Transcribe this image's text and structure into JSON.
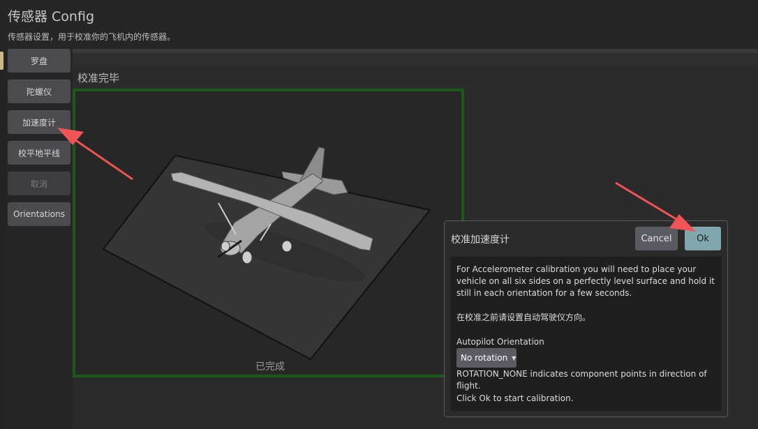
{
  "header": {
    "title": "传感器 Config",
    "subtitle": "传感器设置，用于校准你的飞机内的传感器。"
  },
  "sidebar": {
    "items": [
      {
        "label": "罗盘"
      },
      {
        "label": "陀螺仪"
      },
      {
        "label": "加速度计"
      },
      {
        "label": "校平地平线"
      },
      {
        "label": "取消",
        "disabled": true
      },
      {
        "label": "Orientations"
      }
    ]
  },
  "main": {
    "calibration_title": "校准完毕",
    "done_label": "已完成"
  },
  "dialog": {
    "title": "校准加速度计",
    "cancel_label": "Cancel",
    "ok_label": "Ok",
    "instructions": "For Accelerometer calibration you will need to place your vehicle on all six sides on a perfectly level surface and hold it still in each orientation for a few seconds.",
    "note": "在校准之前请设置自动驾驶仪方向。",
    "orientation_label": "Autopilot Orientation",
    "orientation_value": "No rotation",
    "orientation_help": "ROTATION_NONE indicates component points in direction of flight.",
    "start_hint": "Click Ok to start calibration."
  },
  "colors": {
    "background": "#222222",
    "sidebar_button": "#4a4a4f",
    "frame_border": "#1c5a1c",
    "ok_button": "#7fa7ad",
    "annotation_arrow": "#f05454"
  },
  "icons": {
    "dropdown": "caret-down-icon"
  }
}
